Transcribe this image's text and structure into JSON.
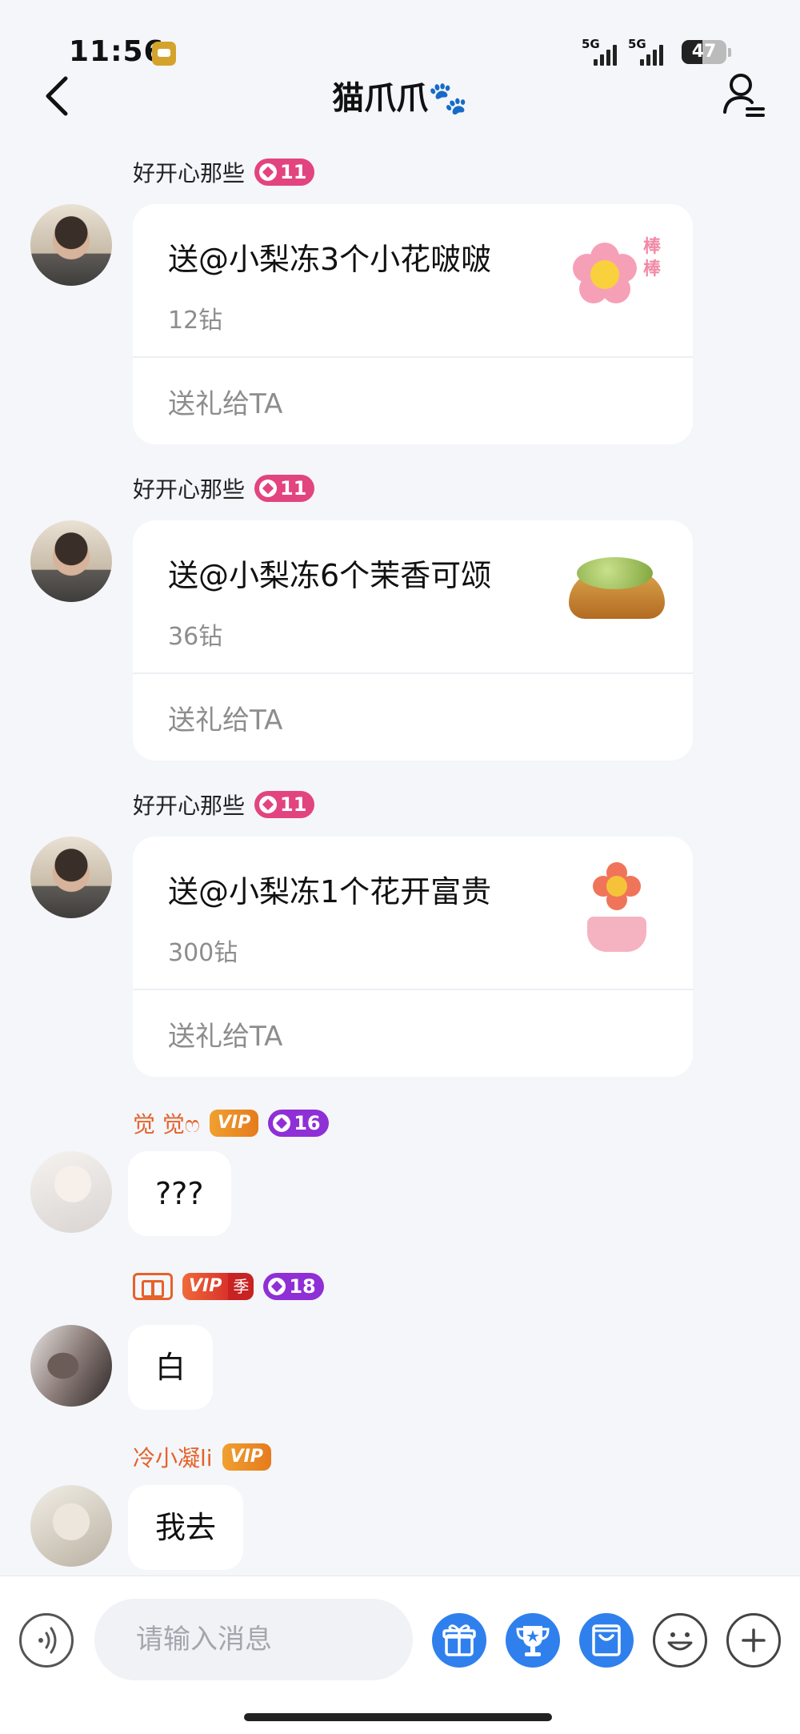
{
  "status_bar": {
    "time": "11:56",
    "signal1": "5G",
    "signal2": "5G",
    "battery": "47",
    "battery_level": 0.47
  },
  "header": {
    "title": "猫爪爪🐾"
  },
  "messages": [
    {
      "user": "好开心那些",
      "level": "11",
      "gift_title": "送@小梨冻3个小花啵啵",
      "gift_price": "12钻",
      "gift_action": "送礼给TA",
      "gift_stamp": "棒棒"
    },
    {
      "user": "好开心那些",
      "level": "11",
      "gift_title": "送@小梨冻6个茉香可颂",
      "gift_price": "36钻",
      "gift_action": "送礼给TA"
    },
    {
      "user": "好开心那些",
      "level": "11",
      "gift_title": "送@小梨冻1个花开富贵",
      "gift_price": "300钻",
      "gift_action": "送礼给TA"
    },
    {
      "user": "觉 觉ෆ",
      "vip": "VIP",
      "level": "16",
      "text": "???"
    },
    {
      "vip": "VIP",
      "vip_season": "季",
      "level": "18",
      "text": "白"
    },
    {
      "user": "冷小凝li",
      "vip": "VIP",
      "text": "我去"
    }
  ],
  "input": {
    "placeholder": "请输入消息"
  },
  "icons": {
    "back": "chevron-left-icon",
    "profile": "user-menu-icon",
    "voice": "voice-icon",
    "gift": "gift-icon",
    "trophy": "trophy-icon",
    "bag": "shopping-bag-icon",
    "emoji": "smile-icon",
    "plus": "plus-icon"
  },
  "colors": {
    "accent": "#2f80ed",
    "level_pink": "#e2447f",
    "level_purple": "#8f2fd6",
    "vip_orange": "#e57b1e",
    "username_orange": "#e5622a"
  }
}
